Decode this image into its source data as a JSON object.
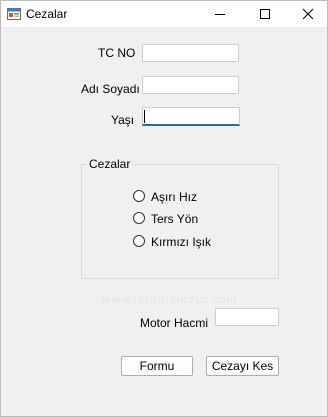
{
  "window": {
    "title": "Cezalar"
  },
  "form": {
    "tc_no_label": "TC NO",
    "tc_no_value": "",
    "adi_soyadi_label": "Adı Soyadı",
    "adi_soyadi_value": "",
    "yasi_label": "Yaşı",
    "yasi_value": "",
    "motor_hacmi_label": "Motor Hacmi",
    "motor_hacmi_value": ""
  },
  "group": {
    "caption": "Cezalar",
    "options": [
      {
        "label": "Aşırı Hız",
        "checked": false
      },
      {
        "label": "Ters Yön",
        "checked": false
      },
      {
        "label": "Kırmızı Işık",
        "checked": false
      }
    ]
  },
  "buttons": {
    "formu": "Formu",
    "cezayi_kes": "Cezayı Kes"
  },
  "watermark": "www.ibrahimkaya.com",
  "colors": {
    "focus_underline": "#2a6aa8",
    "window_bg": "#f0f0f0"
  },
  "icons": {
    "app": "form-app-icon",
    "minimize": "minimize-icon",
    "maximize": "maximize-icon",
    "close": "close-icon"
  }
}
